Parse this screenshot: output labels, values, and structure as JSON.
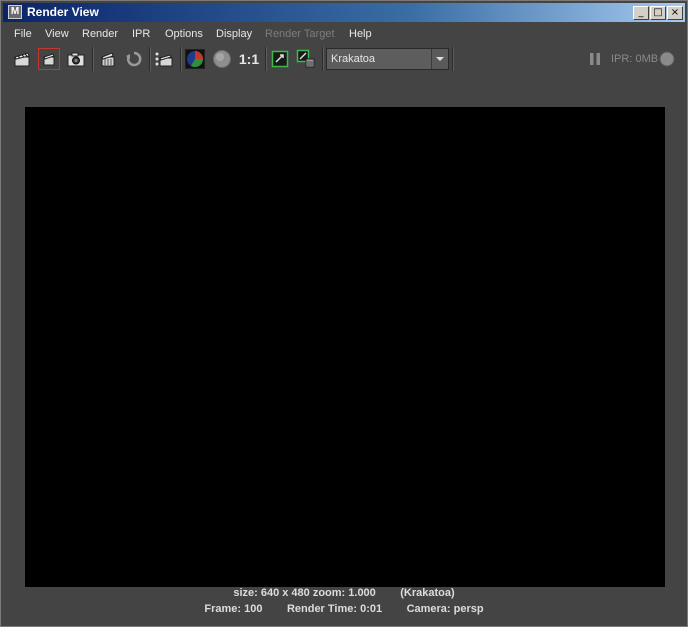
{
  "window": {
    "title": "Render View",
    "title_icon": "maya-icon",
    "controls": {
      "minimize": "_",
      "maximize": "□",
      "close": "×"
    }
  },
  "menu": [
    {
      "label": "File",
      "enabled": true
    },
    {
      "label": "View",
      "enabled": true
    },
    {
      "label": "Render",
      "enabled": true
    },
    {
      "label": "IPR",
      "enabled": true
    },
    {
      "label": "Options",
      "enabled": true
    },
    {
      "label": "Display",
      "enabled": true
    },
    {
      "label": "Render Target",
      "enabled": false
    },
    {
      "label": "Help",
      "enabled": true
    }
  ],
  "toolbar": {
    "icons": [
      "clapper-render-icon",
      "render-region-icon",
      "snapshot-camera-icon",
      "ipr-clapper-icon",
      "refresh-icon",
      "render-settings-icon",
      "rgb-channels-icon",
      "alpha-channel-icon",
      "keep-image-icon",
      "remove-image-icon"
    ],
    "zoom_ratio": "1:1",
    "renderer_select": {
      "value": "Krakatoa"
    },
    "ipr_status": "IPR: 0MB"
  },
  "status": {
    "line1": "size: 640 x 480 zoom: 1.000        (Krakatoa)",
    "frame": "Frame: 100",
    "render_time": "Render Time: 0:01",
    "camera": "Camera: persp"
  },
  "colors": {
    "panel_bg": "#444444",
    "canvas_bg": "#000000",
    "titlebar_start": "#0a246a",
    "titlebar_end": "#a6caf0"
  }
}
